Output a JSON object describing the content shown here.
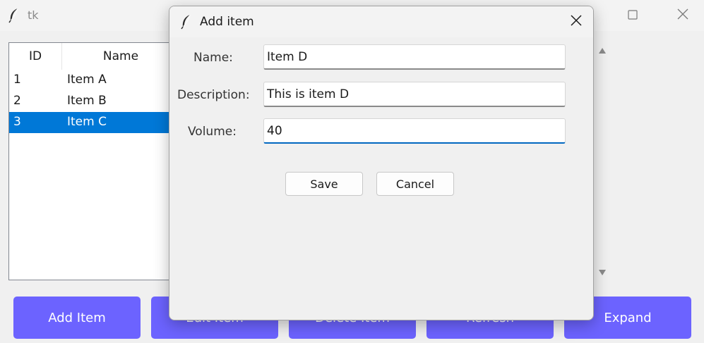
{
  "main_window": {
    "title": "tk",
    "tree": {
      "columns": [
        "ID",
        "Name"
      ],
      "rows": [
        {
          "id": "1",
          "name": "Item A",
          "selected": false
        },
        {
          "id": "2",
          "name": "Item B",
          "selected": false
        },
        {
          "id": "3",
          "name": "Item C",
          "selected": true
        }
      ]
    },
    "buttons": {
      "add": "Add Item",
      "edit": "Edit Item",
      "delete": "Delete Item",
      "refresh": "Refresh",
      "expand": "Expand"
    },
    "colors": {
      "button_bg": "#6c63ff",
      "selection": "#0078d7"
    }
  },
  "dialog": {
    "title": "Add item",
    "fields": {
      "name": {
        "label": "Name:",
        "value": "Item D"
      },
      "description": {
        "label": "Description:",
        "value": "This is item D"
      },
      "volume": {
        "label": "Volume:",
        "value": "40"
      }
    },
    "buttons": {
      "save": "Save",
      "cancel": "Cancel"
    }
  },
  "icons": {
    "app": "feather-icon",
    "maximize": "maximize-icon",
    "close": "close-icon",
    "scroll_up": "arrow-up-icon",
    "scroll_down": "arrow-down-icon"
  }
}
